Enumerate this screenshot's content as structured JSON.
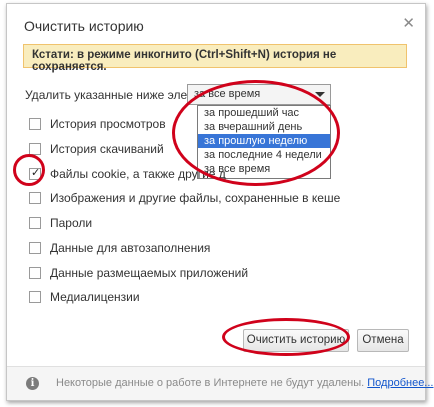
{
  "dialog": {
    "title": "Очистить историю",
    "close_icon": "✕",
    "notice": "Кстати: в режиме инкогнито (Ctrl+Shift+N) история не сохраняется.",
    "remove_label": "Удалить указанные ниже элементы",
    "period": {
      "selected": "за все время",
      "options": [
        "за прошедший час",
        "за вчерашний день",
        "за прошлую неделю",
        "за последние 4 недели",
        "за все время"
      ],
      "highlighted_index": 2
    },
    "items": [
      {
        "label": "История просмотров",
        "checked": false
      },
      {
        "label": "История скачиваний",
        "checked": false
      },
      {
        "label": "Файлы cookie, а также другие д",
        "checked": true
      },
      {
        "label": "Изображения и другие файлы, сохраненные в кеше",
        "checked": false
      },
      {
        "label": "Пароли",
        "checked": false
      },
      {
        "label": "Данные для автозаполнения",
        "checked": false
      },
      {
        "label": "Данные размещаемых приложений",
        "checked": false
      },
      {
        "label": "Медиалицензии",
        "checked": false
      }
    ],
    "buttons": {
      "clear": "Очистить историю",
      "cancel": "Отмена"
    },
    "footer": {
      "text": "Некоторые данные о работе в Интернете не будут удалены.",
      "link": "Подробнее..."
    },
    "annotation_color": "#d0021b"
  }
}
